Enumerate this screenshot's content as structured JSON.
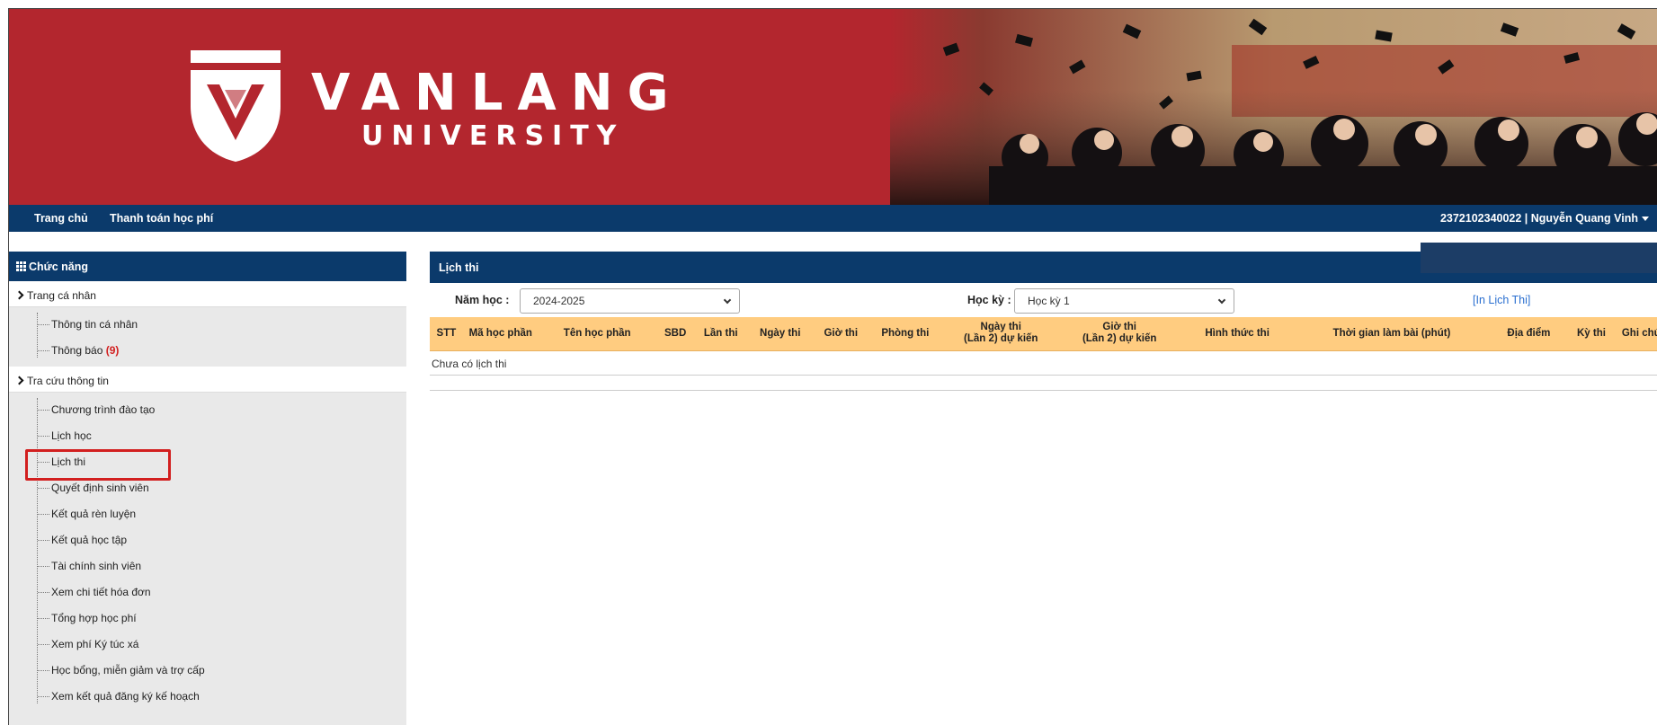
{
  "banner": {
    "brand_line1": "VANLANG",
    "brand_line2": "UNIVERSITY",
    "color": "#b3262e"
  },
  "topnav": {
    "items": [
      "Trang chủ",
      "Thanh toán học phí"
    ],
    "user": "2372102340022 | Nguyễn Quang Vinh",
    "color": "#0b3a6b"
  },
  "sidebar": {
    "title": "Chức năng",
    "groups": [
      {
        "label": "Trang cá nhân",
        "items": [
          {
            "label": "Thông tin cá nhân"
          },
          {
            "label": "Thông báo ",
            "count": "(9)"
          }
        ]
      },
      {
        "label": "Tra cứu thông tin",
        "items": [
          {
            "label": "Chương trình đào tạo"
          },
          {
            "label": "Lịch học"
          },
          {
            "label": "Lịch thi"
          },
          {
            "label": "Quyết định sinh viên"
          },
          {
            "label": "Kết quả rèn luyện"
          },
          {
            "label": "Kết quả học tập"
          },
          {
            "label": "Tài chính sinh viên"
          },
          {
            "label": "Xem chi tiết hóa đơn"
          },
          {
            "label": "Tổng hợp học phí"
          },
          {
            "label": "Xem phí Ký túc xá"
          },
          {
            "label": "Học bổng, miễn giảm và trợ cấp"
          },
          {
            "label": "Xem kết quả đăng ký kế hoạch"
          }
        ]
      }
    ]
  },
  "main": {
    "title": "Lịch thi",
    "year_label": "Năm học :",
    "year_value": "2024-2025",
    "semester_label": "Học kỳ :",
    "semester_value": "Học kỳ 1",
    "print_link": "[In Lịch Thi]",
    "columns": [
      "STT",
      "Mã học phần",
      "Tên học phần",
      "SBD",
      "Lần thi",
      "Ngày thi",
      "Giờ thi",
      "Phòng thi",
      "Ngày thi\n(Lần 2) dự kiến",
      "Giờ thi\n(Lần 2) dự kiến",
      "Hình thức thi",
      "Thời gian làm bài (phút)",
      "Địa điểm",
      "Kỳ thi",
      "Ghi chú"
    ],
    "empty_message": "Chưa có lịch thi",
    "header_color": "#ffcc80"
  }
}
